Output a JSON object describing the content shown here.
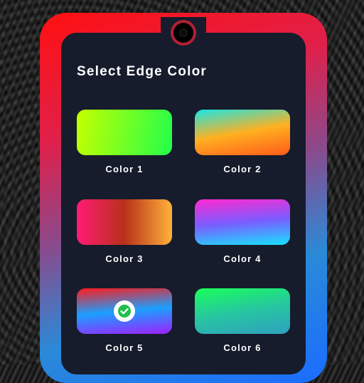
{
  "screen": {
    "title": "Select Edge Color"
  },
  "colors": [
    {
      "label": "Color 1",
      "gradient": [
        "#c6ff00",
        "#22ff4a"
      ],
      "selected": false
    },
    {
      "label": "Color 2",
      "gradient": [
        "#19e6e6",
        "#ffb020",
        "#ff5a1a"
      ],
      "selected": false
    },
    {
      "label": "Color 3",
      "gradient": [
        "#ff1b74",
        "#b8301a",
        "#ffb13a"
      ],
      "selected": false
    },
    {
      "label": "Color 4",
      "gradient": [
        "#ff2ad0",
        "#7a5cff",
        "#18e3ff"
      ],
      "selected": false
    },
    {
      "label": "Color 5",
      "gradient": [
        "#ff1a1a",
        "#1aa0ff",
        "#a020ff"
      ],
      "selected": true
    },
    {
      "label": "Color 6",
      "gradient": [
        "#1aff5a",
        "#27c6a0",
        "#2fa0c0"
      ],
      "selected": false
    }
  ],
  "accent_check": "#1fbf4a"
}
